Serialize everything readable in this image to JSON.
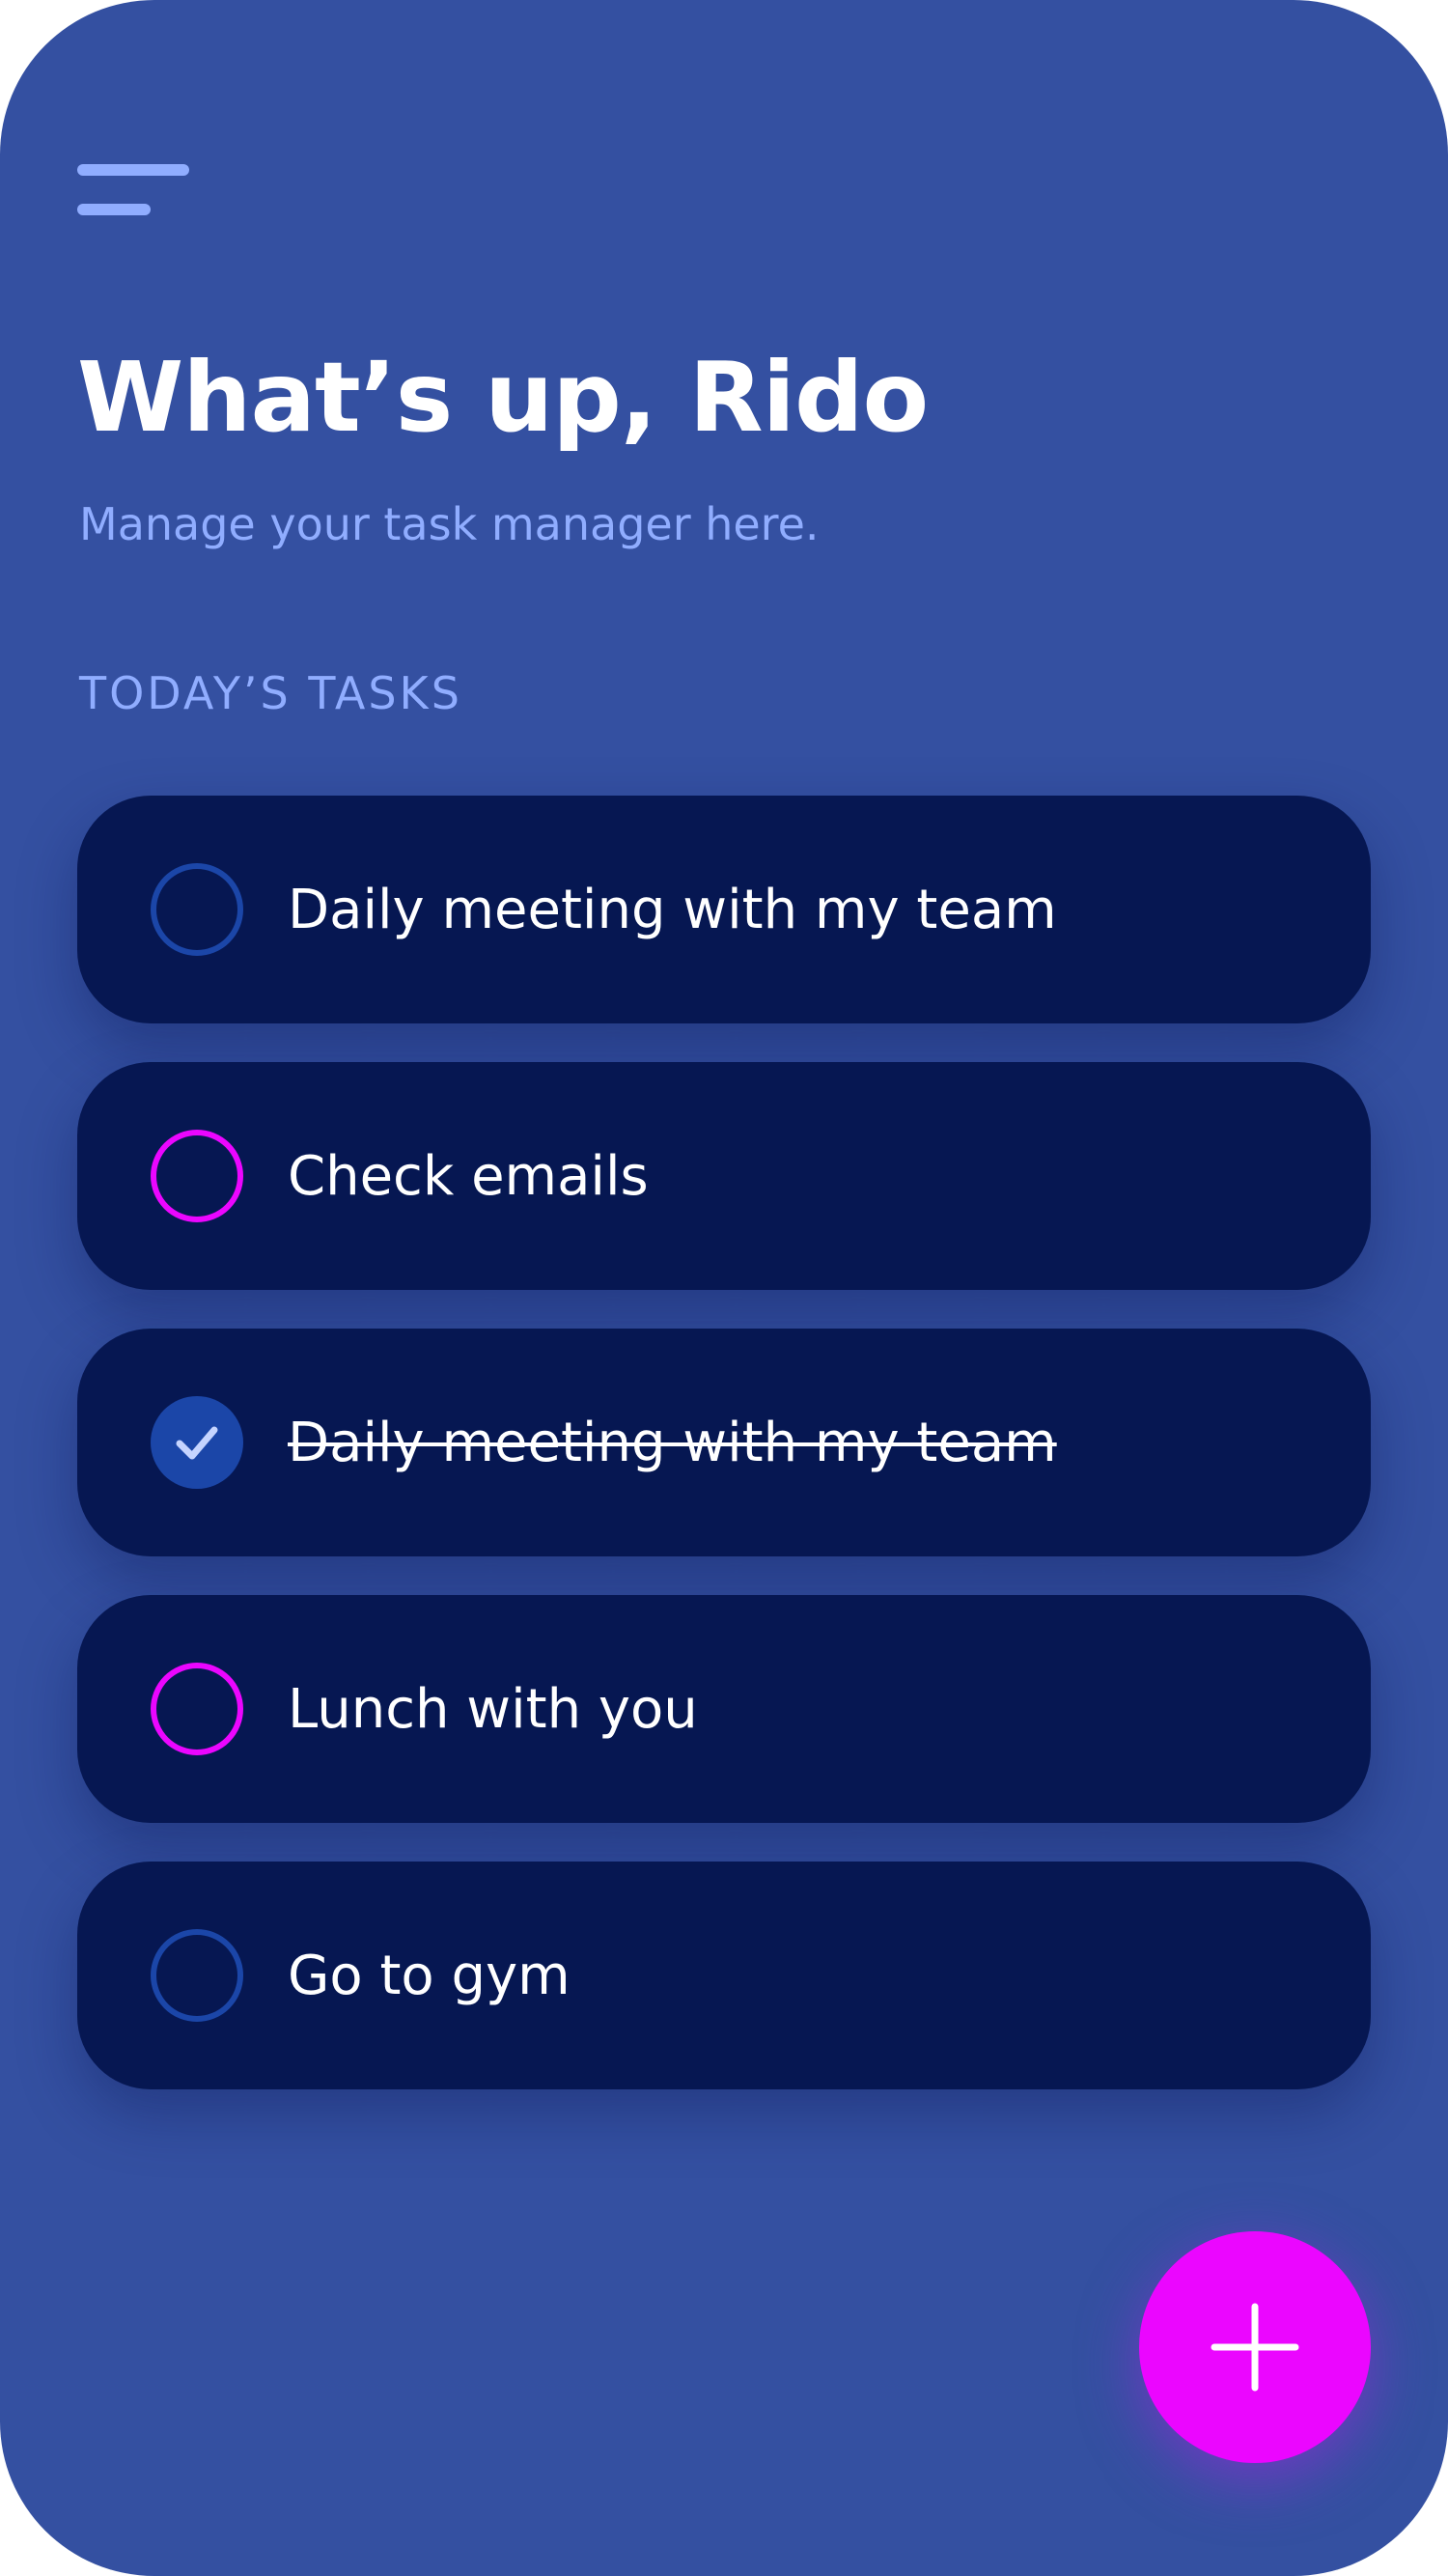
{
  "colors": {
    "background": "#3450a1",
    "card": "#061752",
    "title": "#ffffff",
    "muted_text": "#90adff",
    "task_text": "#ffffff",
    "menu_lines": "#90adff",
    "circle_blue": "#1b46a8",
    "circle_pink": "#eb06ff",
    "check_fill": "#1b46a8",
    "check_mark": "#c5d4ff",
    "fab": "#eb06ff",
    "fab_plus": "#ffffff"
  },
  "header": {
    "menu_icon": "hamburger-menu-icon",
    "title": "What’s up, Rido",
    "subtitle": "Manage your task manager here."
  },
  "tasks_section": {
    "heading": "TODAY’S TASKS",
    "items": [
      {
        "label": "Daily meeting with my team",
        "completed": false,
        "circle_color": "#1b46a8"
      },
      {
        "label": "Check emails",
        "completed": false,
        "circle_color": "#eb06ff"
      },
      {
        "label": "Daily meeting with my team",
        "completed": true,
        "circle_color": "#1b46a8"
      },
      {
        "label": "Lunch with you",
        "completed": false,
        "circle_color": "#eb06ff"
      },
      {
        "label": "Go to gym",
        "completed": false,
        "circle_color": "#1b46a8"
      }
    ]
  },
  "fab": {
    "icon": "plus-icon"
  }
}
